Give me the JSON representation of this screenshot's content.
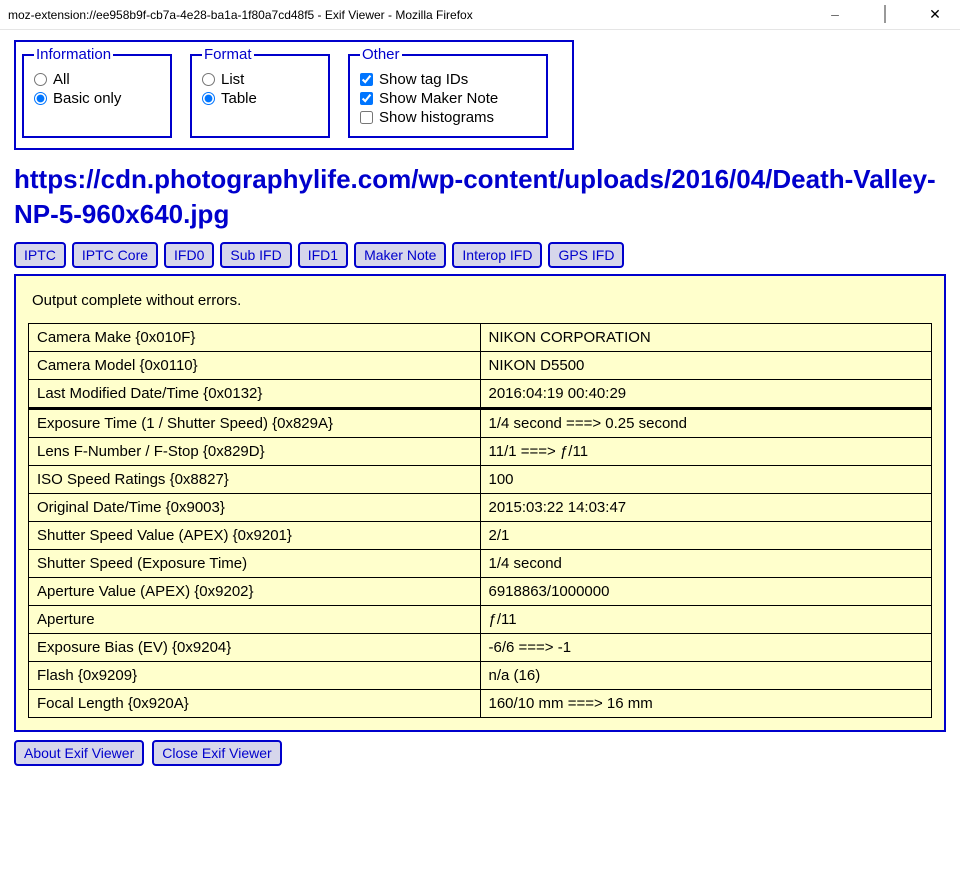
{
  "window": {
    "title": "moz-extension://ee958b9f-cb7a-4e28-ba1a-1f80a7cd48f5 - Exif Viewer - Mozilla Firefox"
  },
  "options": {
    "information": {
      "legend": "Information",
      "all": "All",
      "basic": "Basic only",
      "selected": "basic"
    },
    "format": {
      "legend": "Format",
      "list": "List",
      "table": "Table",
      "selected": "table"
    },
    "other": {
      "legend": "Other",
      "tagids": {
        "label": "Show tag IDs",
        "checked": true
      },
      "makernote": {
        "label": "Show Maker Note",
        "checked": true
      },
      "histograms": {
        "label": "Show histograms",
        "checked": false
      }
    }
  },
  "url_heading": "https://cdn.photographylife.com/wp-content/uploads/2016/04/Death-Valley-NP-5-960x640.jpg",
  "nav": [
    "IPTC",
    "IPTC Core",
    "IFD0",
    "Sub IFD",
    "IFD1",
    "Maker Note",
    "Interop IFD",
    "GPS IFD"
  ],
  "status": "Output complete without errors.",
  "rows": [
    {
      "label": "Camera Make {0x010F}",
      "value": "NIKON CORPORATION"
    },
    {
      "label": "Camera Model {0x0110}",
      "value": "NIKON D5500"
    },
    {
      "label": "Last Modified Date/Time {0x0132}",
      "value": "2016:04:19 00:40:29"
    },
    {
      "label": "Exposure Time (1 / Shutter Speed) {0x829A}",
      "value": "1/4 second ===> 0.25 second",
      "heavy": true
    },
    {
      "label": "Lens F-Number / F-Stop {0x829D}",
      "value": "11/1 ===> ƒ/11"
    },
    {
      "label": "ISO Speed Ratings {0x8827}",
      "value": "100"
    },
    {
      "label": "Original Date/Time {0x9003}",
      "value": "2015:03:22 14:03:47"
    },
    {
      "label": "Shutter Speed Value (APEX) {0x9201}",
      "value": "2/1"
    },
    {
      "label": "Shutter Speed (Exposure Time)",
      "value": "1/4 second"
    },
    {
      "label": "Aperture Value (APEX) {0x9202}",
      "value": "6918863/1000000"
    },
    {
      "label": "Aperture",
      "value": "ƒ/11"
    },
    {
      "label": "Exposure Bias (EV) {0x9204}",
      "value": "-6/6 ===> -1"
    },
    {
      "label": "Flash {0x9209}",
      "value": "n/a (16)"
    },
    {
      "label": "Focal Length {0x920A}",
      "value": "160/10 mm ===> 16 mm"
    }
  ],
  "bottom": {
    "about": "About Exif Viewer",
    "close": "Close Exif Viewer"
  }
}
